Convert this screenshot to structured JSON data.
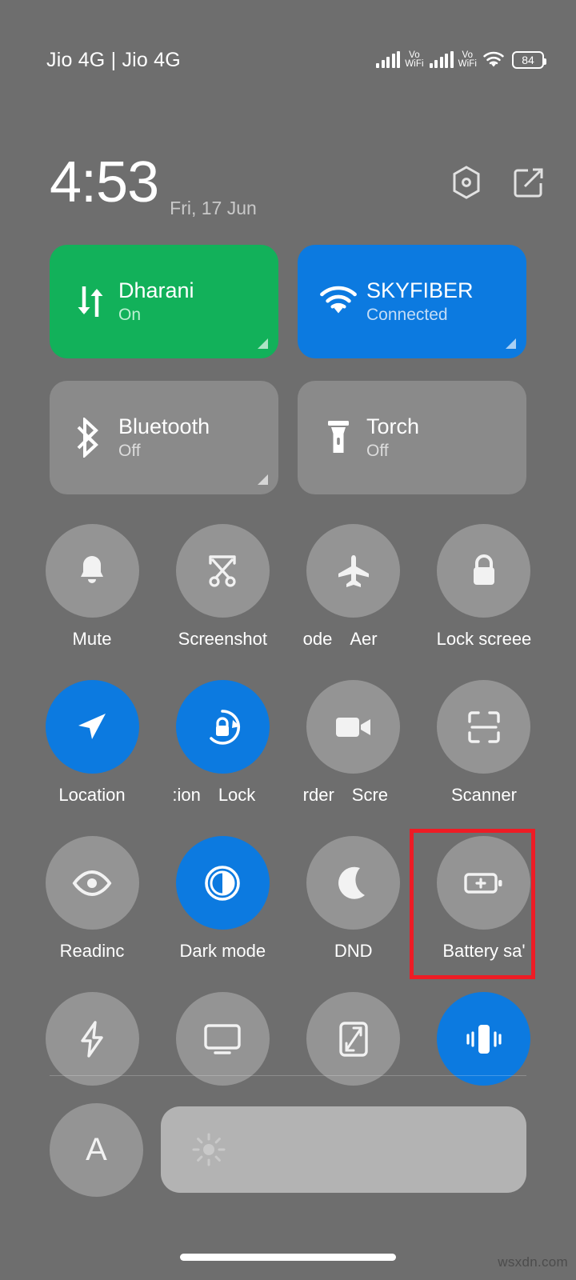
{
  "colors": {
    "background": "#6e6e6e",
    "tile_inactive": "#8a8a8a",
    "circle_inactive": "#949494",
    "accent_blue": "#0c7ae0",
    "accent_green": "#12b15a",
    "highlight_red": "#ee1c25",
    "slider_track": "#b3b3b3"
  },
  "status_bar": {
    "carrier": "Jio 4G | Jio 4G",
    "signal_1": {
      "icon": "signal-bars-icon",
      "label_line1": "Vo",
      "label_line2": "WiFi"
    },
    "signal_2": {
      "icon": "signal-bars-icon",
      "label_line1": "Vo",
      "label_line2": "WiFi"
    },
    "wifi": {
      "icon": "wifi-icon"
    },
    "battery": {
      "icon": "battery-icon",
      "level": "84"
    }
  },
  "clock": {
    "time": "4:53",
    "date": "Fri, 17 Jun",
    "settings_icon": "settings-hexagon-icon",
    "edit_icon": "edit-pencil-icon"
  },
  "big_tiles": [
    {
      "name": "mobile-data",
      "title": "Dharani",
      "subtitle": "On",
      "icon": "data-transfer-icon",
      "state": "green",
      "has_expand": true
    },
    {
      "name": "wifi",
      "title": "SKYFIBER",
      "subtitle": "Connected",
      "icon": "wifi-icon",
      "state": "blue",
      "has_expand": true
    },
    {
      "name": "bluetooth",
      "title": "Bluetooth",
      "subtitle": "Off",
      "icon": "bluetooth-icon",
      "state": "gray",
      "has_expand": true
    },
    {
      "name": "torch",
      "title": "Torch",
      "subtitle": "Off",
      "icon": "flashlight-icon",
      "state": "gray",
      "has_expand": false
    }
  ],
  "toggles": {
    "row1": [
      {
        "name": "mute",
        "label": "Mute",
        "icon": "bell-icon",
        "active": false
      },
      {
        "name": "screenshot",
        "label": "Screenshot",
        "icon": "scissors-icon",
        "active": false
      },
      {
        "name": "aeroplane-mode",
        "label": "ode",
        "label_2": "Aer",
        "marquee": true,
        "icon": "airplane-icon",
        "active": false
      },
      {
        "name": "lock-screen",
        "label": "Lock screee",
        "icon": "lock-icon",
        "active": false
      }
    ],
    "row2": [
      {
        "name": "location",
        "label": "Location",
        "icon": "navigation-arrow-icon",
        "active": true
      },
      {
        "name": "auto-rotation-lock",
        "label": ":ion",
        "label_2": "Lock",
        "marquee": true,
        "icon": "rotation-lock-icon",
        "active": true
      },
      {
        "name": "screen-recorder",
        "label": "rder",
        "label_2": "Scre",
        "marquee": true,
        "icon": "video-camera-icon",
        "active": false
      },
      {
        "name": "scanner",
        "label": "Scanner",
        "icon": "scan-frame-icon",
        "active": false
      }
    ],
    "row3": [
      {
        "name": "reading-mode",
        "label": "Readinc",
        "icon": "eye-icon",
        "active": false
      },
      {
        "name": "dark-mode",
        "label": "Dark mode",
        "icon": "contrast-circle-icon",
        "active": true
      },
      {
        "name": "dnd",
        "label": "DND",
        "icon": "moon-icon",
        "active": false
      },
      {
        "name": "battery-saver",
        "label": "Battery sa'",
        "icon": "battery-plus-icon",
        "active": false,
        "highlighted": true
      }
    ],
    "row4": [
      {
        "name": "quick-charge",
        "label": "",
        "icon": "lightning-bolt-icon",
        "active": false
      },
      {
        "name": "cast",
        "label": "",
        "icon": "monitor-cast-icon",
        "active": false
      },
      {
        "name": "fullscreen-resize",
        "label": "",
        "icon": "resize-diagonal-icon",
        "active": false
      },
      {
        "name": "vibrate",
        "label": "",
        "icon": "vibrate-icon",
        "active": true
      }
    ]
  },
  "brightness": {
    "auto_label": "A",
    "slider_icon": "sun-icon"
  },
  "watermark": "wsxdn.com"
}
